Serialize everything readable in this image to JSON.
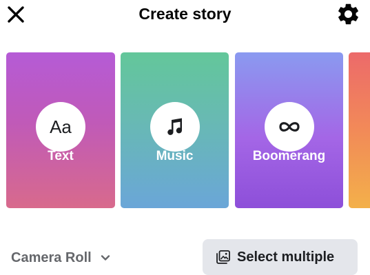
{
  "header": {
    "title": "Create story",
    "close_icon": "close-icon",
    "settings_icon": "gear-icon"
  },
  "cards": [
    {
      "id": "text",
      "label": "Text",
      "icon_glyph": "Aa",
      "icon": "text-aa-icon",
      "colors": [
        "#b55bd6",
        "#d86a8c"
      ]
    },
    {
      "id": "music",
      "label": "Music",
      "icon": "music-note-icon",
      "colors": [
        "#63c79a",
        "#6aa6d8"
      ]
    },
    {
      "id": "boomerang",
      "label": "Boomerang",
      "icon": "infinity-icon",
      "colors": [
        "#8a9af0",
        "#8d4fd9"
      ]
    },
    {
      "id": "partial",
      "label": "",
      "icon": "",
      "colors": [
        "#ec6a6a",
        "#f3b04a"
      ]
    }
  ],
  "footer": {
    "source_label": "Camera Roll",
    "source_icon": "chevron-down-icon",
    "select_multiple_label": "Select multiple",
    "select_multiple_icon": "multiple-photos-icon"
  }
}
